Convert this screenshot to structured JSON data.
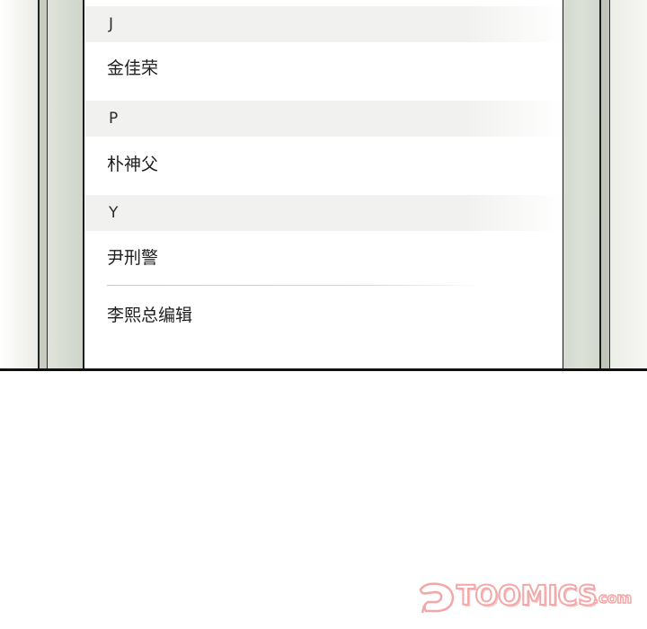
{
  "contacts": {
    "sections": [
      {
        "letter": "J",
        "items": [
          "金佳荣"
        ]
      },
      {
        "letter": "P",
        "items": [
          "朴神父"
        ]
      },
      {
        "letter": "Y",
        "items": [
          "尹刑警",
          "李熙总编辑"
        ]
      }
    ]
  },
  "watermark": {
    "brand": "TOOMICS",
    "domain": ".com",
    "color": "#f2a8a8"
  }
}
